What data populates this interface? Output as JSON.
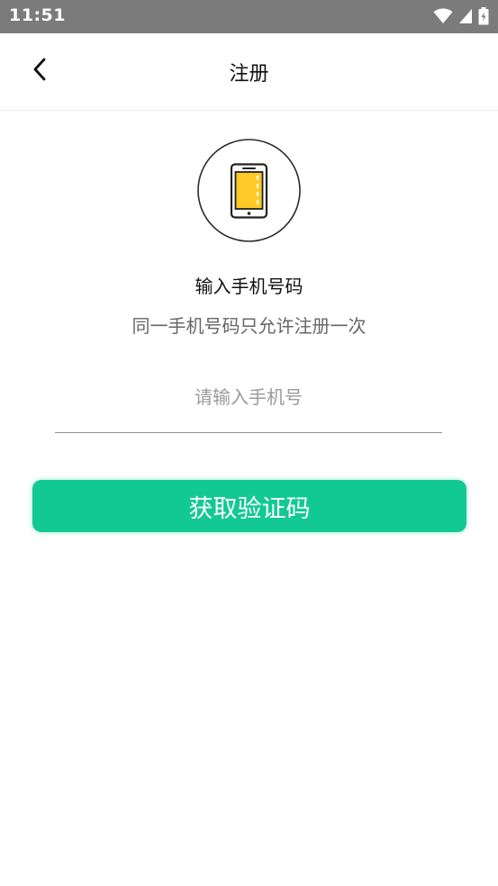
{
  "status_bar": {
    "time": "11:51",
    "icons": [
      "wifi-icon",
      "signal-icon",
      "battery-icon"
    ]
  },
  "header": {
    "back_icon": "chevron-left-icon",
    "title": "注册"
  },
  "hero": {
    "icon": "phone-icon",
    "heading": "输入手机号码",
    "subtitle": "同一手机号码只允许注册一次"
  },
  "form": {
    "phone_placeholder": "请输入手机号",
    "phone_value": ""
  },
  "actions": {
    "get_code_label": "获取验证码"
  },
  "colors": {
    "accent": "#13C993",
    "status_bar": "#7B7B7B",
    "icon_screen": "#FFC927"
  }
}
